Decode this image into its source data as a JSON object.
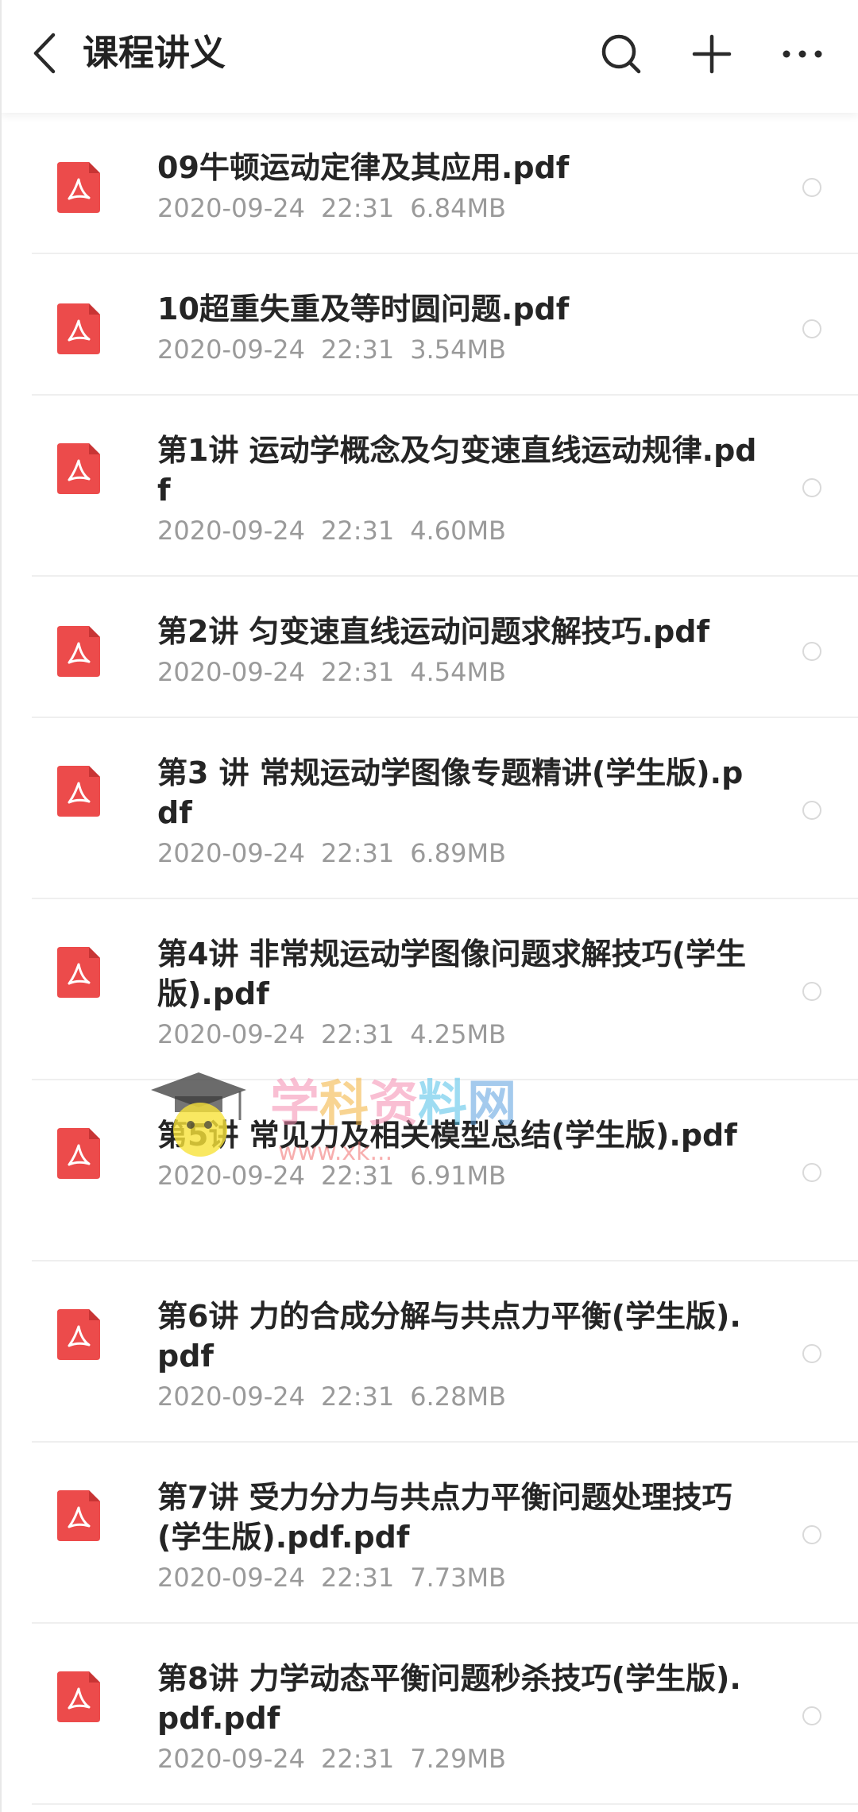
{
  "header": {
    "title": "课程讲义",
    "back_icon": "chevron-left-icon",
    "search_icon": "search-icon",
    "add_icon": "plus-icon",
    "more_icon": "more-horizontal-icon"
  },
  "colors": {
    "pdf_red": "#ec4b4b",
    "title_text": "#252525",
    "meta_text": "#9a9a9a",
    "divider": "#efefef"
  },
  "watermark": {
    "brand": "学科资料网",
    "url": "www.xk..."
  },
  "files": [
    {
      "name": "09牛顿运动定律及其应用.pdf",
      "date": "2020-09-24",
      "time": "22:31",
      "size": "6.84MB"
    },
    {
      "name": "10超重失重及等时圆问题.pdf",
      "date": "2020-09-24",
      "time": "22:31",
      "size": "3.54MB"
    },
    {
      "name": "第1讲 运动学概念及匀变速直线运动规律.pdf",
      "date": "2020-09-24",
      "time": "22:31",
      "size": "4.60MB"
    },
    {
      "name": "第2讲 匀变速直线运动问题求解技巧.pdf",
      "date": "2020-09-24",
      "time": "22:31",
      "size": "4.54MB"
    },
    {
      "name": "第3 讲 常规运动学图像专题精讲(学生版).pdf",
      "date": "2020-09-24",
      "time": "22:31",
      "size": "6.89MB"
    },
    {
      "name": "第4讲 非常规运动学图像问题求解技巧(学生版).pdf",
      "date": "2020-09-24",
      "time": "22:31",
      "size": "4.25MB"
    },
    {
      "name": "第5讲 常见力及相关模型总结(学生版).pdf",
      "date": "2020-09-24",
      "time": "22:31",
      "size": "6.91MB"
    },
    {
      "name": "第6讲 力的合成分解与共点力平衡(学生版).pdf",
      "date": "2020-09-24",
      "time": "22:31",
      "size": "6.28MB"
    },
    {
      "name": "第7讲 受力分力与共点力平衡问题处理技巧(学生版).pdf.pdf",
      "date": "2020-09-24",
      "time": "22:31",
      "size": "7.73MB"
    },
    {
      "name": "第8讲 力学动态平衡问题秒杀技巧(学生版).pdf.pdf",
      "date": "2020-09-24",
      "time": "22:31",
      "size": "7.29MB"
    }
  ]
}
